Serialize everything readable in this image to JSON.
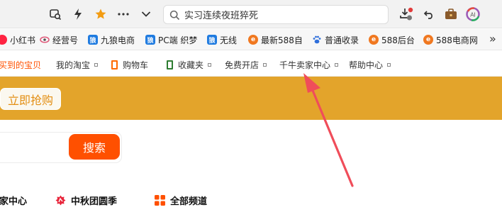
{
  "toolbar": {
    "url_text": "实习连续夜班猝死"
  },
  "bookmarks": [
    {
      "label": "小红书",
      "icon": "xiaohongshu-icon",
      "color": "#ff2442",
      "glyph": "书"
    },
    {
      "label": "经营号",
      "icon": "eye-icon",
      "color": "#e05a7a",
      "glyph": ""
    },
    {
      "label": "九狼电商",
      "icon": "wolf-icon",
      "color": "#1f7be0",
      "glyph": "狼"
    },
    {
      "label": "PC端 织梦",
      "icon": "wolf-icon",
      "color": "#1f7be0",
      "glyph": "狼"
    },
    {
      "label": "无线",
      "icon": "wolf-icon",
      "color": "#1f7be0",
      "glyph": "狼"
    },
    {
      "label": "最新588自",
      "icon": "e-logo-icon",
      "color": "#f07820",
      "glyph": "e"
    },
    {
      "label": "普通收录",
      "icon": "paw-icon",
      "color": "#2f6fdb",
      "glyph": "🐾"
    },
    {
      "label": "588后台",
      "icon": "e-logo-icon",
      "color": "#f07820",
      "glyph": "e"
    },
    {
      "label": "588电商网",
      "icon": "e-logo-icon",
      "color": "#f07820",
      "glyph": "e"
    }
  ],
  "bookmarks_more": "»",
  "pagenav": {
    "items": [
      "买到的宝贝",
      "我的淘宝",
      "购物车",
      "收藏夹",
      "免费开店",
      "千牛卖家中心",
      "帮助中心"
    ]
  },
  "banner": {
    "button_label": "立即抢购"
  },
  "search": {
    "button_label": "搜索"
  },
  "channels": {
    "items": [
      "卖家中心",
      "中秋团圆季",
      "全部频道"
    ]
  },
  "colors": {
    "banner": "#e3a42b",
    "search_button": "#ff5000",
    "accent_orange": "#f07820",
    "arrow": "#f04d5a"
  }
}
